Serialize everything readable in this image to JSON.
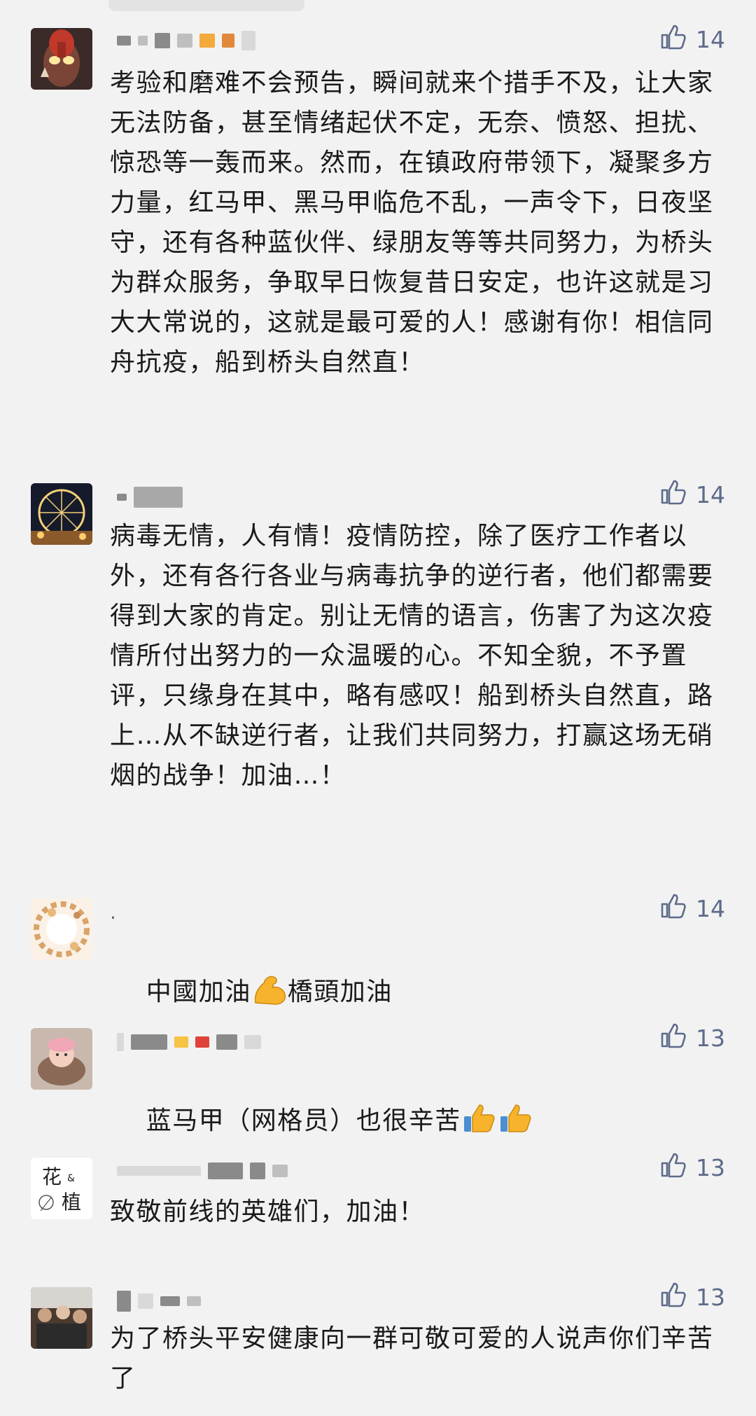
{
  "comments": [
    {
      "name": "",
      "likes": "14",
      "text": "考验和磨难不会预告，瞬间就来个措手不及，让大家无法防备，甚至情绪起伏不定，无奈、愤怒、担扰、惊恐等一轰而来。然而，在镇政府带领下，凝聚多方力量，红马甲、黑马甲临危不乱，一声令下，日夜坚守，还有各种蓝伙伴、绿朋友等等共同努力，为桥头为群众服务，争取早日恢复昔日安定，也许这就是习大大常说的，这就是最可爱的人！感谢有你！相信同舟抗疫，船到桥头自然直！"
    },
    {
      "name": "",
      "likes": "14",
      "text": "病毒无情，人有情！疫情防控，除了医疗工作者以外，还有各行各业与病毒抗争的逆行者，他们都需要得到大家的肯定。别让无情的语言，伤害了为这次疫情所付出努力的一众温暖的心。不知全貌，不予置评，只缘身在其中，略有感叹！船到桥头自然直，路上…从不缺逆行者，让我们共同努力，打赢这场无硝烟的战争！加油…！"
    },
    {
      "name": ".",
      "likes": "14",
      "text_before": "中國加油",
      "text_after": "橋頭加油"
    },
    {
      "name": "",
      "likes": "13",
      "text": "蓝马甲（网格员）也很辛苦"
    },
    {
      "name": "",
      "likes": "13",
      "text": "致敬前线的英雄们，加油！",
      "avatar_text_top": "花",
      "avatar_text_amp": "&",
      "avatar_text_bottom": "植"
    },
    {
      "name": "",
      "likes": "13",
      "text": "为了桥头平安健康向一群可敬可爱的人说声你们辛苦了"
    }
  ],
  "icons": {
    "like": "thumbs-up-outline-icon",
    "muscle": "flexed-biceps-emoji",
    "thumb": "thumbs-up-emoji"
  },
  "colors": {
    "background": "#f2f2f2",
    "like_count": "#5d6b8a",
    "text": "#1a1a1a"
  }
}
